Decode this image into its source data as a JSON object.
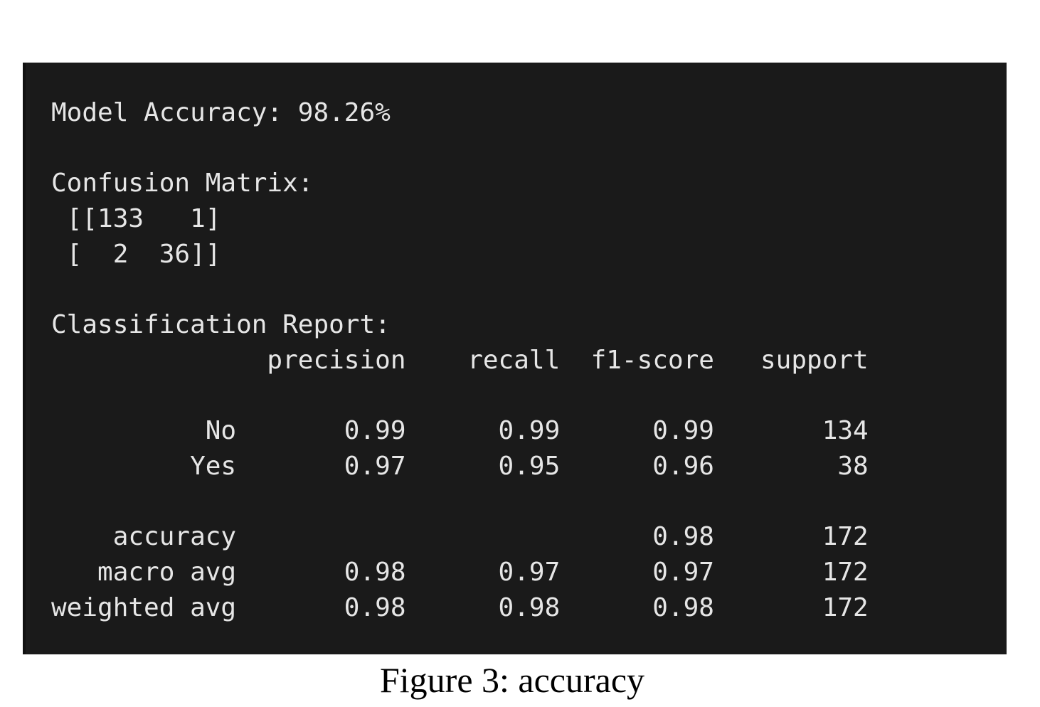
{
  "terminal": {
    "background": "#1a1a1a",
    "text_color": "#e6e6e6",
    "lines": [
      "Model Accuracy: 98.26%",
      "",
      "Confusion Matrix:",
      " [[133   1]",
      " [  2  36]]",
      "",
      "Classification Report:",
      "              precision    recall  f1-score   support",
      "",
      "          No       0.99      0.99      0.99       134",
      "         Yes       0.97      0.95      0.96        38",
      "",
      "    accuracy                           0.98       172",
      "   macro avg       0.98      0.97      0.97       172",
      "weighted avg       0.98      0.98      0.98       172"
    ]
  },
  "caption": "Figure 3: accuracy"
}
